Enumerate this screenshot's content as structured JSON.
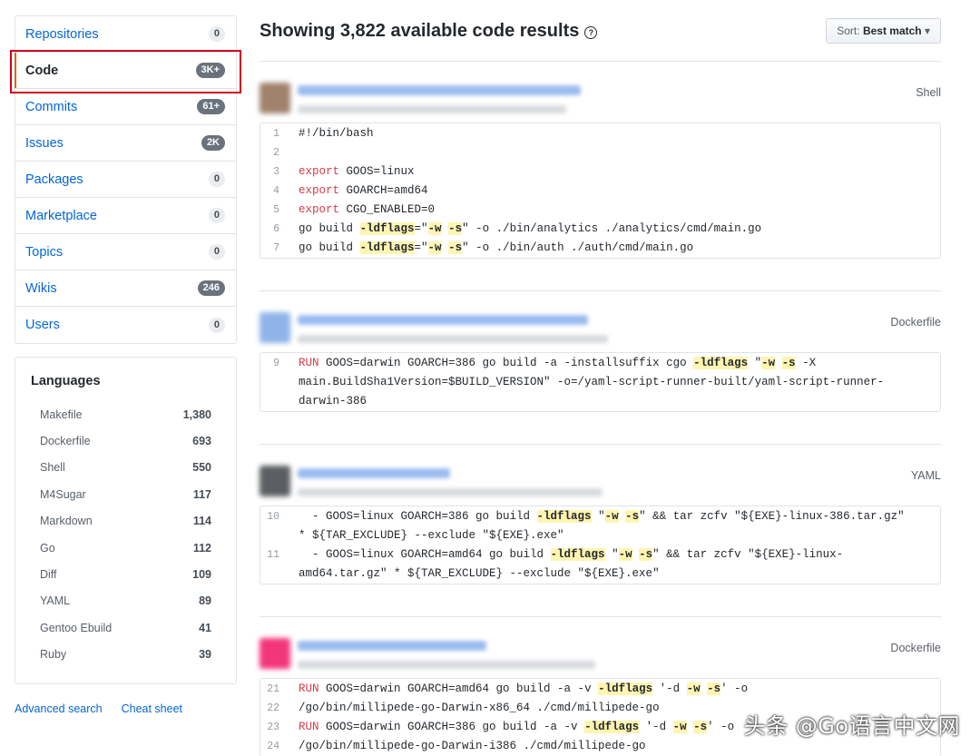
{
  "nav": [
    {
      "label": "Repositories",
      "count": "0",
      "dark": false,
      "selected": false
    },
    {
      "label": "Code",
      "count": "3K+",
      "dark": true,
      "selected": true
    },
    {
      "label": "Commits",
      "count": "61+",
      "dark": true,
      "selected": false
    },
    {
      "label": "Issues",
      "count": "2K",
      "dark": true,
      "selected": false
    },
    {
      "label": "Packages",
      "count": "0",
      "dark": false,
      "selected": false
    },
    {
      "label": "Marketplace",
      "count": "0",
      "dark": false,
      "selected": false
    },
    {
      "label": "Topics",
      "count": "0",
      "dark": false,
      "selected": false
    },
    {
      "label": "Wikis",
      "count": "246",
      "dark": true,
      "selected": false
    },
    {
      "label": "Users",
      "count": "0",
      "dark": false,
      "selected": false
    }
  ],
  "languages": {
    "title": "Languages",
    "items": [
      {
        "name": "Makefile",
        "count": "1,380"
      },
      {
        "name": "Dockerfile",
        "count": "693"
      },
      {
        "name": "Shell",
        "count": "550"
      },
      {
        "name": "M4Sugar",
        "count": "117"
      },
      {
        "name": "Markdown",
        "count": "114"
      },
      {
        "name": "Go",
        "count": "112"
      },
      {
        "name": "Diff",
        "count": "109"
      },
      {
        "name": "YAML",
        "count": "89"
      },
      {
        "name": "Gentoo Ebuild",
        "count": "41"
      },
      {
        "name": "Ruby",
        "count": "39"
      }
    ]
  },
  "footer": {
    "advanced_search": "Advanced search",
    "cheat_sheet": "Cheat sheet"
  },
  "header": {
    "title": "Showing 3,822 available code results",
    "help_icon": "question-circle-icon",
    "sort_prefix": "Sort:",
    "sort_value": "Best match"
  },
  "results": [
    {
      "language": "Shell",
      "avatar_color": "#a0826d",
      "lines": [
        {
          "n": "1",
          "parts": [
            {
              "t": "#!/bin/bash",
              "c": "ct"
            }
          ]
        },
        {
          "n": "2",
          "parts": []
        },
        {
          "n": "3",
          "parts": [
            {
              "t": "export",
              "c": "kw"
            },
            {
              "t": " GOOS=linux",
              "c": "ct"
            }
          ]
        },
        {
          "n": "4",
          "parts": [
            {
              "t": "export",
              "c": "kw"
            },
            {
              "t": " GOARCH=amd64",
              "c": "ct"
            }
          ]
        },
        {
          "n": "5",
          "parts": [
            {
              "t": "export",
              "c": "kw"
            },
            {
              "t": " CGO_ENABLED=0",
              "c": "ct"
            }
          ]
        },
        {
          "n": "6",
          "parts": [
            {
              "t": "go build ",
              "c": "ct"
            },
            {
              "t": "-ldflags",
              "c": "hl"
            },
            {
              "t": "=\"",
              "c": "ct"
            },
            {
              "t": "-w",
              "c": "hl"
            },
            {
              "t": " ",
              "c": "ct"
            },
            {
              "t": "-s",
              "c": "hl"
            },
            {
              "t": "\" -o ./bin/analytics ./analytics/cmd/main.go",
              "c": "ct"
            }
          ]
        },
        {
          "n": "7",
          "parts": [
            {
              "t": "go build ",
              "c": "ct"
            },
            {
              "t": "-ldflags",
              "c": "hl"
            },
            {
              "t": "=\"",
              "c": "ct"
            },
            {
              "t": "-w",
              "c": "hl"
            },
            {
              "t": " ",
              "c": "ct"
            },
            {
              "t": "-s",
              "c": "hl"
            },
            {
              "t": "\" -o ./bin/auth ./auth/cmd/main.go",
              "c": "ct"
            }
          ]
        }
      ]
    },
    {
      "language": "Dockerfile",
      "avatar_color": "#8fb4e8",
      "lines": [
        {
          "n": "9",
          "parts": [
            {
              "t": "RUN",
              "c": "kw"
            },
            {
              "t": " GOOS=darwin GOARCH=386 go build -a -installsuffix cgo ",
              "c": "ct"
            },
            {
              "t": "-ldflags",
              "c": "hl"
            },
            {
              "t": " \"",
              "c": "ct"
            },
            {
              "t": "-w",
              "c": "hl"
            },
            {
              "t": " ",
              "c": "ct"
            },
            {
              "t": "-s",
              "c": "hl"
            },
            {
              "t": " -X",
              "c": "ct"
            }
          ]
        },
        {
          "n": "",
          "parts": [
            {
              "t": "main.BuildSha1Version=$BUILD_VERSION\" -o=/yaml-script-runner-built/yaml-script-runner-",
              "c": "ct"
            }
          ]
        },
        {
          "n": "",
          "parts": [
            {
              "t": "darwin-386",
              "c": "ct"
            }
          ]
        }
      ]
    },
    {
      "language": "YAML",
      "avatar_color": "#5b5e63",
      "lines": [
        {
          "n": "10",
          "parts": [
            {
              "t": "  - GOOS=linux GOARCH=386 go build ",
              "c": "ct"
            },
            {
              "t": "-ldflags",
              "c": "hl"
            },
            {
              "t": " \"",
              "c": "ct"
            },
            {
              "t": "-w",
              "c": "hl"
            },
            {
              "t": " ",
              "c": "ct"
            },
            {
              "t": "-s",
              "c": "hl"
            },
            {
              "t": "\" && tar zcfv \"${EXE}-linux-386.tar.gz\"",
              "c": "ct"
            }
          ]
        },
        {
          "n": "",
          "parts": [
            {
              "t": "* ${TAR_EXCLUDE} --exclude \"${EXE}.exe\"",
              "c": "ct"
            }
          ]
        },
        {
          "n": "11",
          "parts": [
            {
              "t": "  - GOOS=linux GOARCH=amd64 go build ",
              "c": "ct"
            },
            {
              "t": "-ldflags",
              "c": "hl"
            },
            {
              "t": " \"",
              "c": "ct"
            },
            {
              "t": "-w",
              "c": "hl"
            },
            {
              "t": " ",
              "c": "ct"
            },
            {
              "t": "-s",
              "c": "hl"
            },
            {
              "t": "\" && tar zcfv \"${EXE}-linux-",
              "c": "ct"
            }
          ]
        },
        {
          "n": "",
          "parts": [
            {
              "t": "amd64.tar.gz\" * ${TAR_EXCLUDE} --exclude \"${EXE}.exe\"",
              "c": "ct"
            }
          ]
        }
      ]
    },
    {
      "language": "Dockerfile",
      "avatar_color": "#f2367a",
      "lines": [
        {
          "n": "21",
          "parts": [
            {
              "t": "RUN",
              "c": "kw"
            },
            {
              "t": " GOOS=darwin GOARCH=amd64 go build -a -v ",
              "c": "ct"
            },
            {
              "t": "-ldflags",
              "c": "hl"
            },
            {
              "t": " '-d ",
              "c": "ct"
            },
            {
              "t": "-w",
              "c": "hl"
            },
            {
              "t": " ",
              "c": "ct"
            },
            {
              "t": "-s",
              "c": "hl"
            },
            {
              "t": "' -o",
              "c": "ct"
            }
          ]
        },
        {
          "n": "22",
          "parts": [
            {
              "t": "/go/bin/millipede-go-Darwin-x86_64 ./cmd/millipede-go",
              "c": "ct"
            }
          ]
        },
        {
          "n": "23",
          "parts": [
            {
              "t": "RUN",
              "c": "kw"
            },
            {
              "t": " GOOS=darwin GOARCH=386 go build -a -v ",
              "c": "ct"
            },
            {
              "t": "-ldflags",
              "c": "hl"
            },
            {
              "t": " '-d ",
              "c": "ct"
            },
            {
              "t": "-w",
              "c": "hl"
            },
            {
              "t": " ",
              "c": "ct"
            },
            {
              "t": "-s",
              "c": "hl"
            },
            {
              "t": "' -o",
              "c": "ct"
            }
          ]
        },
        {
          "n": "24",
          "parts": [
            {
              "t": "/go/bin/millipede-go-Darwin-i386 ./cmd/millipede-go",
              "c": "ct"
            }
          ]
        }
      ]
    }
  ],
  "watermark": "头条 @Go语言中文网"
}
